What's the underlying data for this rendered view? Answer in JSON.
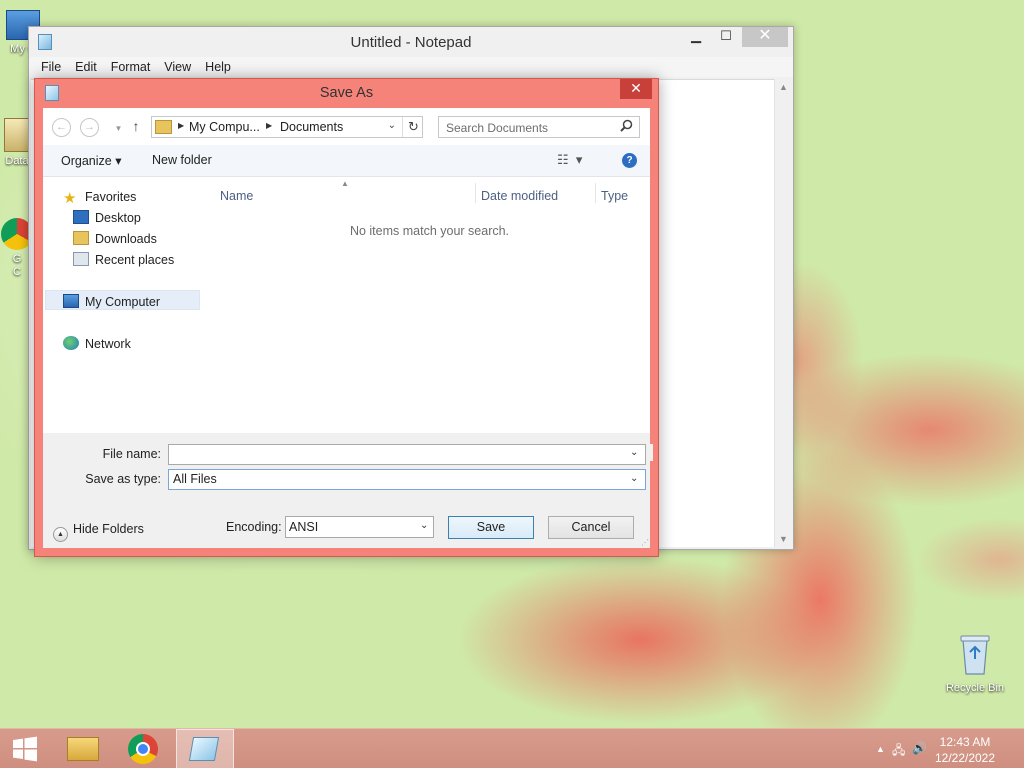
{
  "desktop": {
    "icons": [
      {
        "label": "My C"
      },
      {
        "label": "Data"
      },
      {
        "label": "G\nC"
      },
      {
        "label": "Recycle Bin"
      }
    ]
  },
  "notepad": {
    "title": "Untitled - Notepad",
    "menu": [
      "File",
      "Edit",
      "Format",
      "View",
      "Help"
    ],
    "controls": {
      "minimize": "▁",
      "maximize": "☐",
      "close": "✕"
    }
  },
  "dialog": {
    "title": "Save As",
    "close": "✕",
    "breadcrumb": [
      "My Compu...",
      "Documents"
    ],
    "search_placeholder": "Search Documents",
    "toolbar": {
      "organize": "Organize ▾",
      "new_folder": "New folder"
    },
    "nav": {
      "favorites": "Favorites",
      "desktop": "Desktop",
      "downloads": "Downloads",
      "recent": "Recent places",
      "my_computer": "My Computer",
      "network": "Network"
    },
    "columns": {
      "name": "Name",
      "date": "Date modified",
      "type": "Type"
    },
    "empty_message": "No items match your search.",
    "file_name_label": "File name:",
    "file_name_value": "",
    "save_type_label": "Save as type:",
    "save_type_value": "All Files",
    "hide_folders": "Hide Folders",
    "encoding_label": "Encoding:",
    "encoding_value": "ANSI",
    "save": "Save",
    "cancel": "Cancel"
  },
  "taskbar": {
    "time": "12:43 AM",
    "date": "12/22/2022"
  },
  "colors": {
    "dialog_frame": "#f5837a",
    "taskbar": "#d79b8c",
    "accent": "#3c7fb1"
  }
}
